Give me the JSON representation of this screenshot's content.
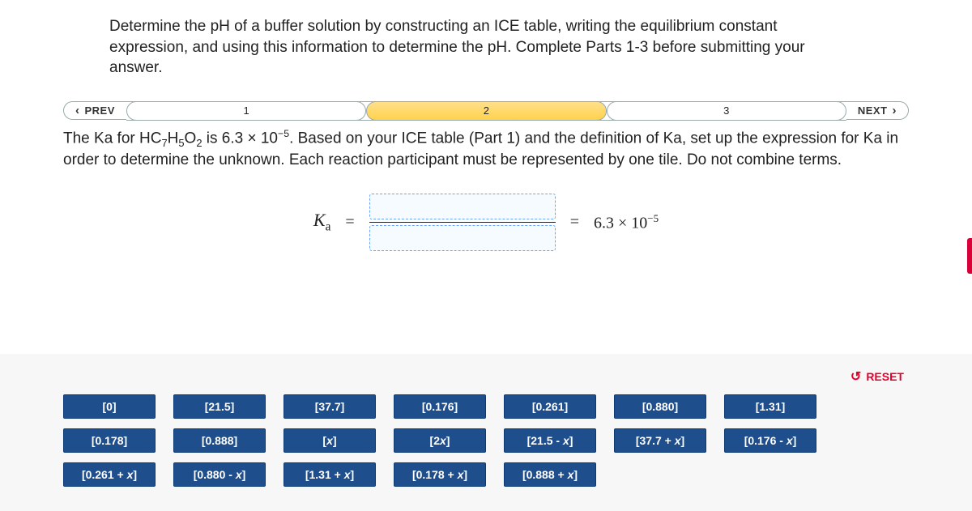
{
  "prompt_text": "Determine the pH of a buffer solution by constructing an ICE table, writing the equilibrium constant expression, and using this information to determine the pH. Complete Parts 1-3 before submitting your answer.",
  "nav": {
    "prev": "PREV",
    "next": "NEXT"
  },
  "steps": {
    "s1": "1",
    "s2": "2",
    "s3": "3",
    "active": 2
  },
  "instruction": {
    "pre": "The Ka for HC",
    "sub1": "7",
    "mid1": "H",
    "sub2": "5",
    "mid2": "O",
    "sub3": "2",
    "mid3": " is 6.3 × 10",
    "sup1": "−5",
    "post": ". Based on your ICE table (Part 1) and the definition of Ka, set up the expression for Ka in order to determine the unknown. Each reaction participant must be represented by one tile. Do not combine terms."
  },
  "equation": {
    "ka_label_base": "K",
    "ka_label_sub": "a",
    "equals": "=",
    "rhs_equals": "=",
    "rhs_value_base": "6.3 × 10",
    "rhs_value_sup": "−5"
  },
  "reset_label": "RESET",
  "tiles": [
    "[0]",
    "[21.5]",
    "[37.7]",
    "[0.176]",
    "[0.261]",
    "[0.880]",
    "[1.31]",
    "[0.178]",
    "[0.888]",
    "[x]",
    "[2x]",
    "[21.5 - x]",
    "[37.7 + x]",
    "[0.176 - x]",
    "[0.261 + x]",
    "[0.880 - x]",
    "[1.31 + x]",
    "[0.178 + x]",
    "[0.888 + x]"
  ]
}
